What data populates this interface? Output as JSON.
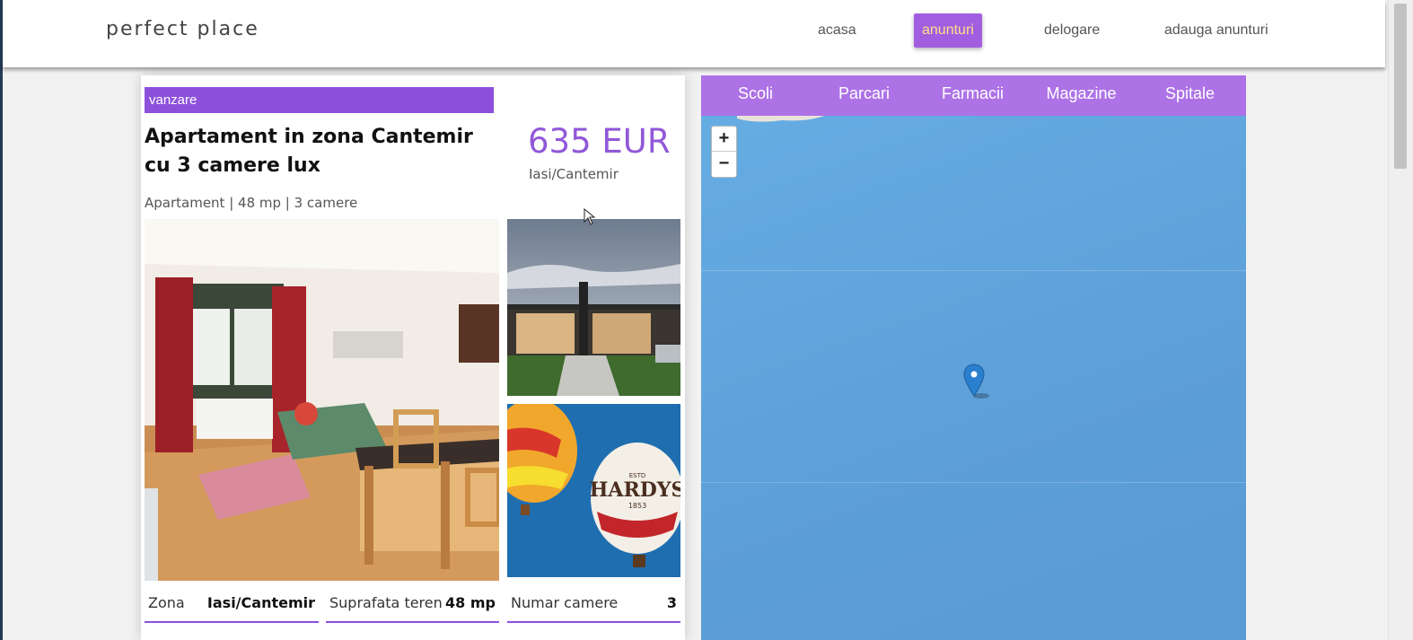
{
  "brand": "perfect place",
  "nav": {
    "items": [
      {
        "label": "acasa",
        "active": false
      },
      {
        "label": "anunturi",
        "active": true
      },
      {
        "label": "delogare",
        "active": false
      },
      {
        "label": "adauga anunturi",
        "active": false
      }
    ]
  },
  "listing": {
    "type": "vanzare",
    "title": "Apartament in zona Cantemir cu 3 camere lux",
    "price": "635 EUR",
    "location": "Iasi/Cantemir",
    "meta": "Apartament | 48 mp | 3 camere",
    "specs": [
      {
        "label": "Zona",
        "value": "Iasi/Cantemir"
      },
      {
        "label": "Suprafata teren",
        "value": "48 mp"
      },
      {
        "label": "Numar camere",
        "value": "3"
      }
    ]
  },
  "map": {
    "tabs": [
      "Scoli",
      "Parcari",
      "Farmacii",
      "Magazine",
      "Spitale"
    ],
    "zoom_in": "+",
    "zoom_out": "−"
  },
  "colors": {
    "accent": "#8c50db",
    "nav_active_bg": "#a25ee0",
    "nav_active_text": "#ffe08a",
    "map_tabs_bg": "#ad72e6",
    "water": "#5fa3dc"
  }
}
